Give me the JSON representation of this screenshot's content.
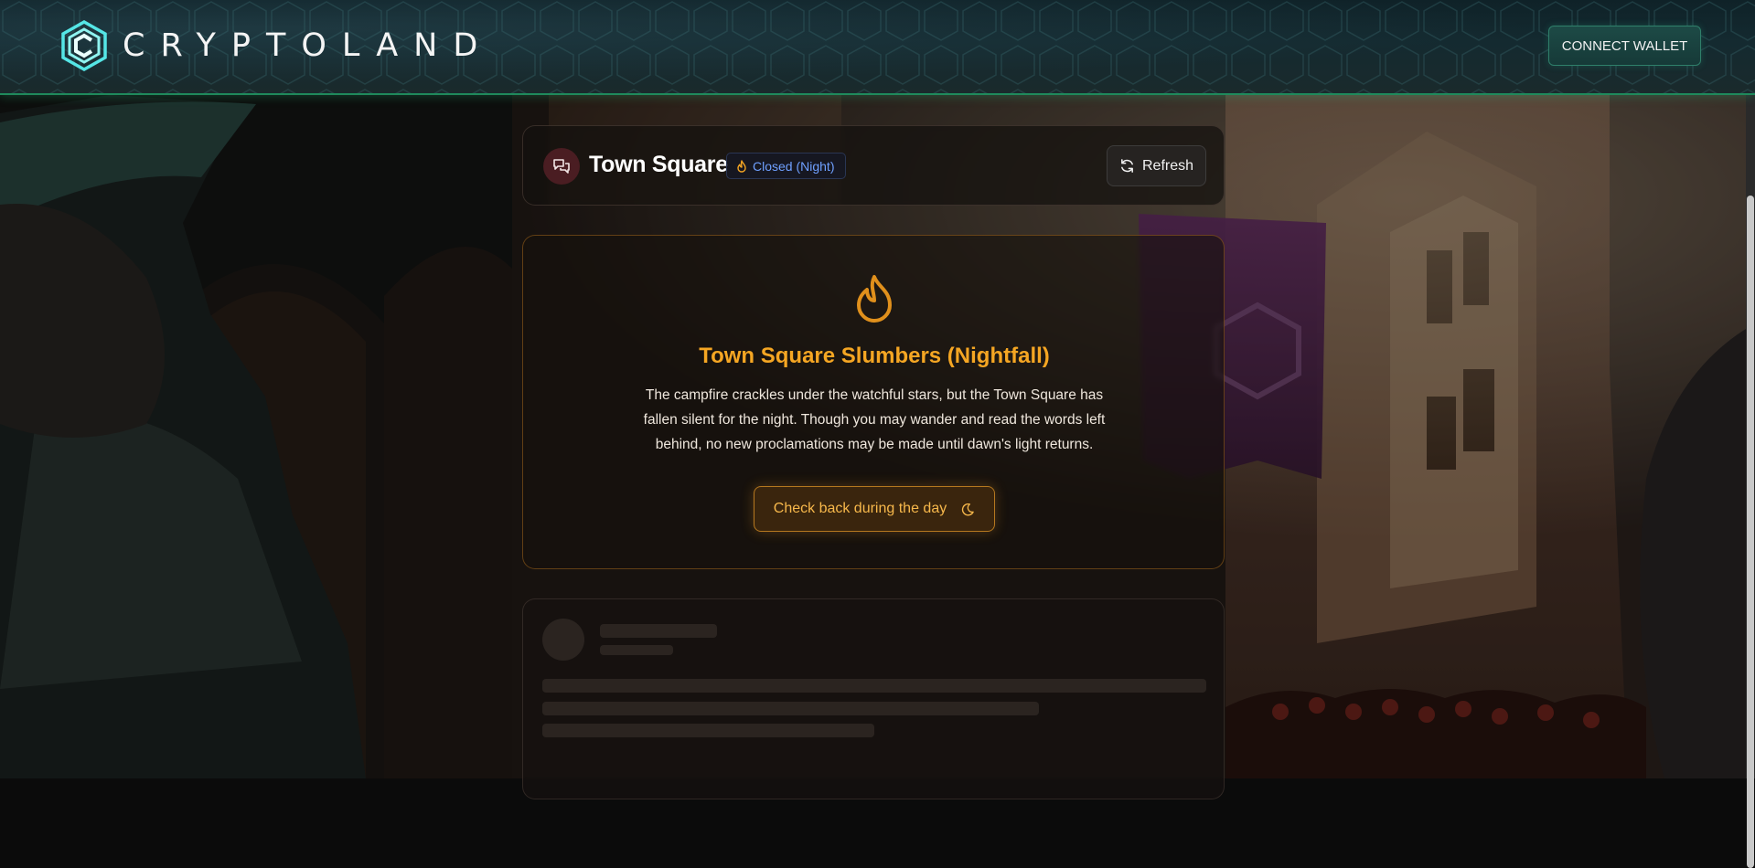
{
  "header": {
    "brand": "CRYPTOLAND",
    "logo_icon": "hex-c-logo",
    "connect_label": "CONNECT WALLET"
  },
  "room": {
    "title": "Town Square",
    "chat_icon": "chat-bubbles-icon",
    "status": "Closed (Night)",
    "status_icon": "flame-icon",
    "refresh_label": "Refresh",
    "refresh_icon": "refresh-icon"
  },
  "night_notice": {
    "icon": "flame-icon",
    "title": "Town Square Slumbers (Nightfall)",
    "description": "The campfire crackles under the watchful stars, but the Town Square has fallen silent for the night. Though you may wander and read the words left behind, no new proclamations may be made until dawn's light returns.",
    "button_label": "Check back during the day",
    "button_icon": "moon-icon"
  },
  "colors": {
    "accent_green": "#1f8a5c",
    "night_orange": "#f5a623",
    "status_blue": "#6fa0ff",
    "chat_icon_bg": "#4a1d22"
  }
}
